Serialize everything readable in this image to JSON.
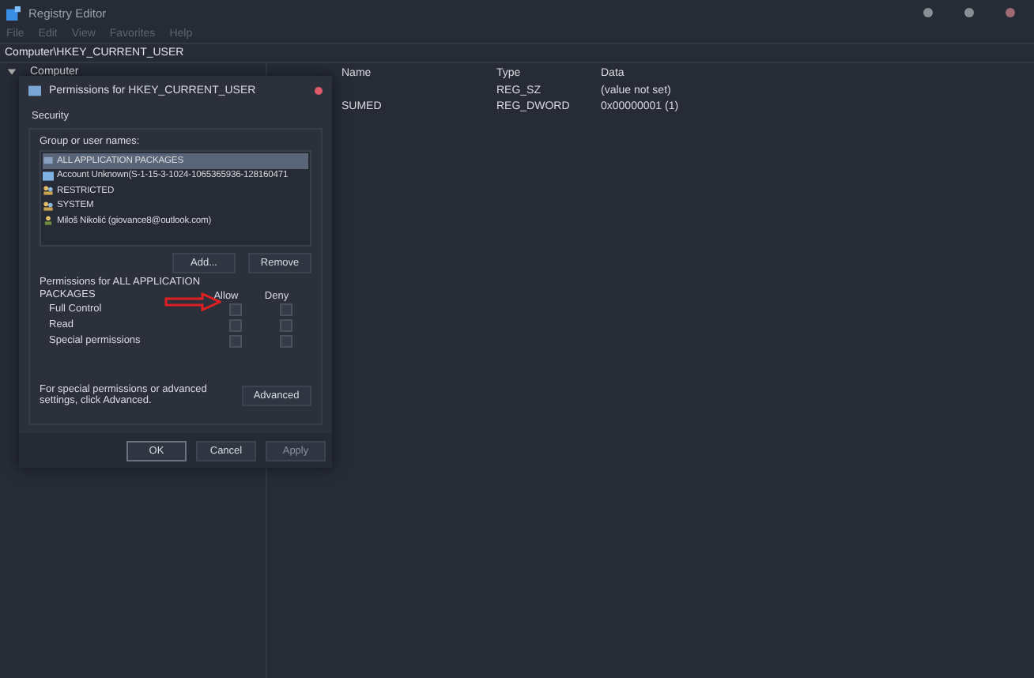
{
  "window": {
    "title": "Registry Editor"
  },
  "menu": [
    "File",
    "Edit",
    "View",
    "Favorites",
    "Help"
  ],
  "address": "Computer\\HKEY_CURRENT_USER",
  "tree": [
    {
      "label": "Computer",
      "expanded": true
    }
  ],
  "list": {
    "columns": [
      "Name",
      "Type",
      "Data"
    ],
    "rows": [
      {
        "name": "",
        "type": "REG_SZ",
        "data": "(value not set)"
      },
      {
        "name": "SUMED",
        "type": "REG_DWORD",
        "data": "0x00000001 (1)"
      }
    ]
  },
  "dialog": {
    "title": "Permissions for HKEY_CURRENT_USER",
    "tab": "Security",
    "group_label": "Group or user names:",
    "users": [
      {
        "name": "ALL APPLICATION PACKAGES",
        "kind": "package",
        "selected": true
      },
      {
        "name": "Account Unknown(S-1-15-3-1024-1065365936-128160471",
        "kind": "unknown",
        "selected": false
      },
      {
        "name": "RESTRICTED",
        "kind": "group",
        "selected": false
      },
      {
        "name": "SYSTEM",
        "kind": "group",
        "selected": false
      },
      {
        "name": "Miloš Nikolić (giovance8@outlook.com)",
        "kind": "user",
        "selected": false
      }
    ],
    "add_button": "Add...",
    "remove_button": "Remove",
    "permissions_label": "Permissions for ALL APPLICATION PACKAGES",
    "allow_label": "Allow",
    "deny_label": "Deny",
    "permissions": [
      {
        "name": "Full Control",
        "allow": false,
        "deny": false
      },
      {
        "name": "Read",
        "allow": false,
        "deny": false
      },
      {
        "name": "Special permissions",
        "allow": false,
        "deny": false
      }
    ],
    "advanced_text": "For special permissions or advanced settings, click Advanced.",
    "advanced_button": "Advanced",
    "buttons": [
      {
        "label": "OK",
        "disabled": false
      },
      {
        "label": "Cancel",
        "disabled": false
      },
      {
        "label": "Apply",
        "disabled": true
      }
    ]
  }
}
